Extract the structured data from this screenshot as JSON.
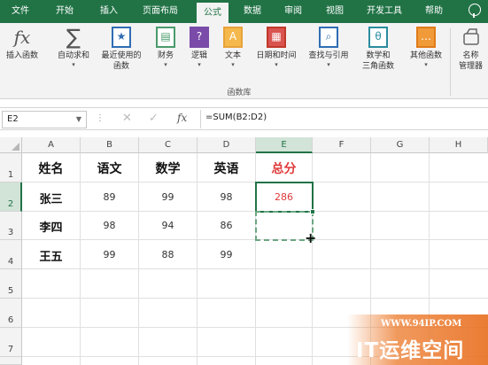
{
  "ribbon_tabs": [
    "文件",
    "开始",
    "插入",
    "页面布局",
    "公式",
    "数据",
    "审阅",
    "视图",
    "开发工具",
    "帮助"
  ],
  "active_tab": "公式",
  "ribbon": {
    "buttons": [
      {
        "label": "插入函数",
        "icon": "fx-icon",
        "dropdown": false
      },
      {
        "label": "自动求和",
        "icon": "sigma-icon",
        "dropdown": true
      },
      {
        "label": "最近使用的\n函数",
        "icon": "recent-functions-icon",
        "dropdown": true
      },
      {
        "label": "财务",
        "icon": "finance-icon",
        "dropdown": true
      },
      {
        "label": "逻辑",
        "icon": "logical-icon",
        "dropdown": true
      },
      {
        "label": "文本",
        "icon": "text-function-icon",
        "dropdown": true
      },
      {
        "label": "日期和时间",
        "icon": "date-time-icon",
        "dropdown": true
      },
      {
        "label": "查找与引用",
        "icon": "lookup-reference-icon",
        "dropdown": true
      },
      {
        "label": "数学和\n三角函数",
        "icon": "math-trig-icon",
        "dropdown": true
      },
      {
        "label": "其他函数",
        "icon": "more-functions-icon",
        "dropdown": true
      },
      {
        "label": "名称\n管理器",
        "icon": "name-manager-icon",
        "dropdown": false
      }
    ],
    "group_label": "函数库"
  },
  "formula_bar": {
    "name_box": "E2",
    "formula": "=SUM(B2:D2)"
  },
  "grid": {
    "columns": [
      "A",
      "B",
      "C",
      "D",
      "E",
      "F",
      "G",
      "H"
    ],
    "selected_column": "E",
    "rows": [
      "1",
      "2",
      "3",
      "4",
      "5",
      "6",
      "7"
    ],
    "selected_row": "2",
    "header_row": [
      "姓名",
      "语文",
      "数学",
      "英语",
      "总分"
    ],
    "data_rows": [
      {
        "name": "张三",
        "scores": [
          "89",
          "99",
          "98"
        ],
        "total": "286"
      },
      {
        "name": "李四",
        "scores": [
          "98",
          "94",
          "86"
        ],
        "total": ""
      },
      {
        "name": "王五",
        "scores": [
          "99",
          "88",
          "99"
        ],
        "total": ""
      }
    ],
    "active_cell": "E2"
  },
  "watermark": {
    "url": "WWW.94IP.COM",
    "title": "IT运维空间"
  },
  "colors": {
    "excel_green": "#217346",
    "total_red": "#e03a3a",
    "watermark_orange": "#e86e1e"
  }
}
